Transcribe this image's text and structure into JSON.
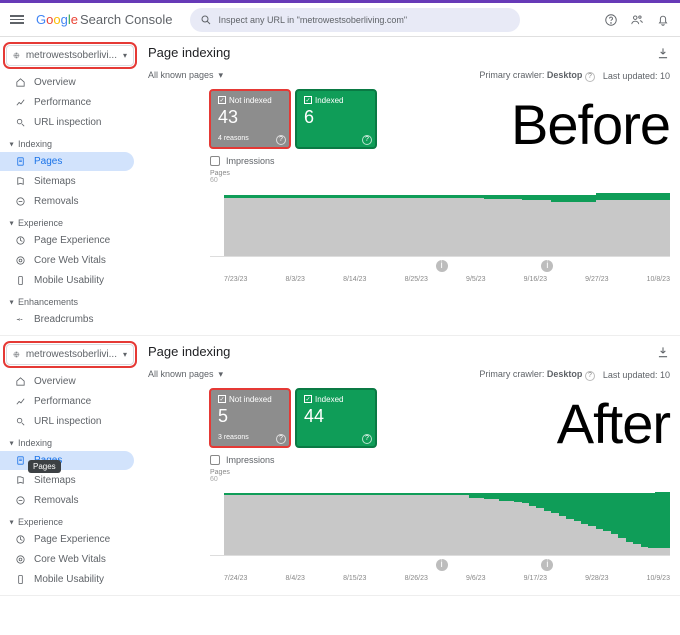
{
  "brand": {
    "name": "Search Console"
  },
  "search": {
    "placeholder": "Inspect any URL in \"metrowestsoberliving.com\""
  },
  "overlay": {
    "before": "Before",
    "after": "After"
  },
  "panels": [
    {
      "property_label": "metrowestsoberlivi...",
      "nav": {
        "overview": "Overview",
        "performance": "Performance",
        "url_inspection": "URL inspection",
        "section_indexing": "Indexing",
        "pages": "Pages",
        "sitemaps": "Sitemaps",
        "removals": "Removals",
        "section_experience": "Experience",
        "page_experience": "Page Experience",
        "cwv": "Core Web Vitals",
        "mobile": "Mobile Usability",
        "section_enhancements": "Enhancements",
        "breadcrumbs": "Breadcrumbs"
      },
      "page_title": "Page indexing",
      "filter_label": "All known pages",
      "primary_crawler_label": "Primary crawler:",
      "primary_crawler_value": "Desktop",
      "last_updated_label": "Last updated:",
      "last_updated_value": "10",
      "card_not_indexed": {
        "label": "Not indexed",
        "value": "43",
        "sub": "4 reasons"
      },
      "card_indexed": {
        "label": "Indexed",
        "value": "6"
      },
      "impressions_label": "Impressions",
      "chart_y_label": "Pages",
      "chart_y_max": "60",
      "chart_x": [
        "7/23/23",
        "8/3/23",
        "8/14/23",
        "8/25/23",
        "9/5/23",
        "9/16/23",
        "9/27/23",
        "10/8/23"
      ],
      "show_tooltip": false
    },
    {
      "property_label": "metrowestsoberlivi...",
      "nav": {
        "overview": "Overview",
        "performance": "Performance",
        "url_inspection": "URL inspection",
        "section_indexing": "Indexing",
        "pages": "Pages",
        "sitemaps": "Sitemaps",
        "removals": "Removals",
        "section_experience": "Experience",
        "page_experience": "Page Experience",
        "cwv": "Core Web Vitals",
        "mobile": "Mobile Usability"
      },
      "page_title": "Page indexing",
      "filter_label": "All known pages",
      "primary_crawler_label": "Primary crawler:",
      "primary_crawler_value": "Desktop",
      "last_updated_label": "Last updated:",
      "last_updated_value": "10",
      "card_not_indexed": {
        "label": "Not indexed",
        "value": "5",
        "sub": "3 reasons"
      },
      "card_indexed": {
        "label": "Indexed",
        "value": "44"
      },
      "impressions_label": "Impressions",
      "chart_y_label": "Pages",
      "chart_y_max": "60",
      "chart_x": [
        "7/24/23",
        "8/4/23",
        "8/15/23",
        "8/26/23",
        "9/6/23",
        "9/17/23",
        "9/28/23",
        "10/9/23"
      ],
      "show_tooltip": true,
      "tooltip_text": "Pages"
    }
  ],
  "chart_data": [
    {
      "type": "bar",
      "title": "Page indexing (Before)",
      "ylabel": "Pages",
      "ylim": [
        0,
        60
      ],
      "categories": [
        "7/23/23",
        "8/3/23",
        "8/14/23",
        "8/25/23",
        "9/5/23",
        "9/16/23",
        "9/27/23",
        "10/8/23"
      ],
      "series": [
        {
          "name": "Indexed",
          "values": [
            2,
            2,
            2,
            2,
            2,
            2,
            2,
            2,
            2,
            2,
            2,
            2,
            2,
            2,
            2,
            2,
            2,
            2,
            2,
            2,
            2,
            2,
            2,
            2,
            2,
            2,
            2,
            2,
            2,
            2,
            2,
            2,
            2,
            2,
            2,
            3,
            3,
            3,
            3,
            3,
            4,
            4,
            4,
            4,
            5,
            5,
            5,
            5,
            5,
            5,
            6,
            6,
            6,
            6,
            6,
            6,
            6,
            6,
            6,
            6
          ]
        },
        {
          "name": "Not indexed",
          "values": [
            45,
            45,
            45,
            45,
            45,
            45,
            45,
            45,
            45,
            45,
            45,
            45,
            45,
            45,
            45,
            45,
            45,
            45,
            45,
            45,
            45,
            45,
            45,
            45,
            45,
            45,
            45,
            45,
            45,
            45,
            45,
            45,
            45,
            45,
            45,
            44,
            44,
            44,
            44,
            44,
            43,
            43,
            43,
            43,
            42,
            42,
            42,
            42,
            42,
            42,
            43,
            43,
            43,
            43,
            43,
            43,
            43,
            43,
            43,
            43
          ]
        }
      ]
    },
    {
      "type": "bar",
      "title": "Page indexing (After)",
      "ylabel": "Pages",
      "ylim": [
        0,
        60
      ],
      "categories": [
        "7/24/23",
        "8/4/23",
        "8/15/23",
        "8/26/23",
        "9/6/23",
        "9/17/23",
        "9/28/23",
        "10/9/23"
      ],
      "series": [
        {
          "name": "Indexed",
          "values": [
            2,
            2,
            2,
            2,
            2,
            2,
            2,
            2,
            2,
            2,
            2,
            2,
            2,
            2,
            2,
            2,
            2,
            2,
            2,
            2,
            2,
            2,
            2,
            2,
            2,
            2,
            2,
            2,
            2,
            2,
            2,
            2,
            2,
            4,
            4,
            5,
            5,
            6,
            6,
            7,
            8,
            10,
            12,
            14,
            16,
            18,
            20,
            22,
            24,
            26,
            28,
            30,
            32,
            35,
            38,
            40,
            42,
            43,
            44,
            44
          ]
        },
        {
          "name": "Not indexed",
          "values": [
            46,
            46,
            46,
            46,
            46,
            46,
            46,
            46,
            46,
            46,
            46,
            46,
            46,
            46,
            46,
            46,
            46,
            46,
            46,
            46,
            46,
            46,
            46,
            46,
            46,
            46,
            46,
            46,
            46,
            46,
            46,
            46,
            46,
            44,
            44,
            43,
            43,
            42,
            42,
            41,
            40,
            38,
            36,
            34,
            32,
            30,
            28,
            26,
            24,
            22,
            20,
            18,
            16,
            13,
            10,
            8,
            6,
            5,
            5,
            5
          ]
        }
      ]
    }
  ]
}
